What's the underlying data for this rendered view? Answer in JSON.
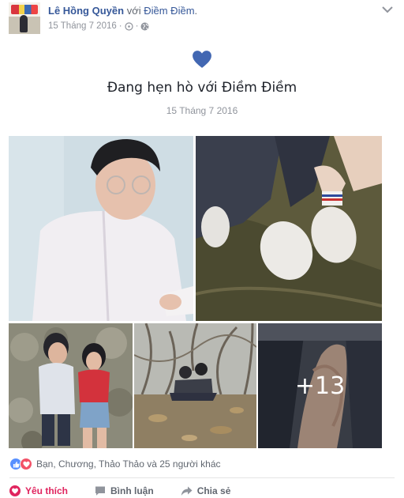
{
  "post": {
    "author": "Lê Hồng Quyền",
    "with_text": "với",
    "tagged_name": "Điềm Điềm",
    "tagged_suffix": ".",
    "timestamp": "15 Tháng 7 2016",
    "separator": "·",
    "privacy_icon": "globe-icon",
    "options_icon": "chevron-down-icon"
  },
  "life_event": {
    "icon": "heart-icon",
    "icon_color": "#4267b2",
    "title": "Đang hẹn hò với Điềm Điềm",
    "date": "15 Tháng 7 2016"
  },
  "photos": {
    "items": [
      "photo-man-reading",
      "photo-sneakers-grass",
      "photo-couple-standing",
      "photo-couple-sitting-woods",
      "photo-holding-hands"
    ],
    "more_count": "+13"
  },
  "reactions": {
    "icons": [
      "like-icon",
      "love-icon"
    ],
    "like_color": "#5890ff",
    "love_color": "#f25268",
    "summary": "Bạn, Chương, Thảo Thảo và 25 người khác"
  },
  "actions": {
    "love_label": "Yêu thích",
    "love_color": "#e0245e",
    "comment_label": "Bình luận",
    "share_label": "Chia sẻ"
  }
}
